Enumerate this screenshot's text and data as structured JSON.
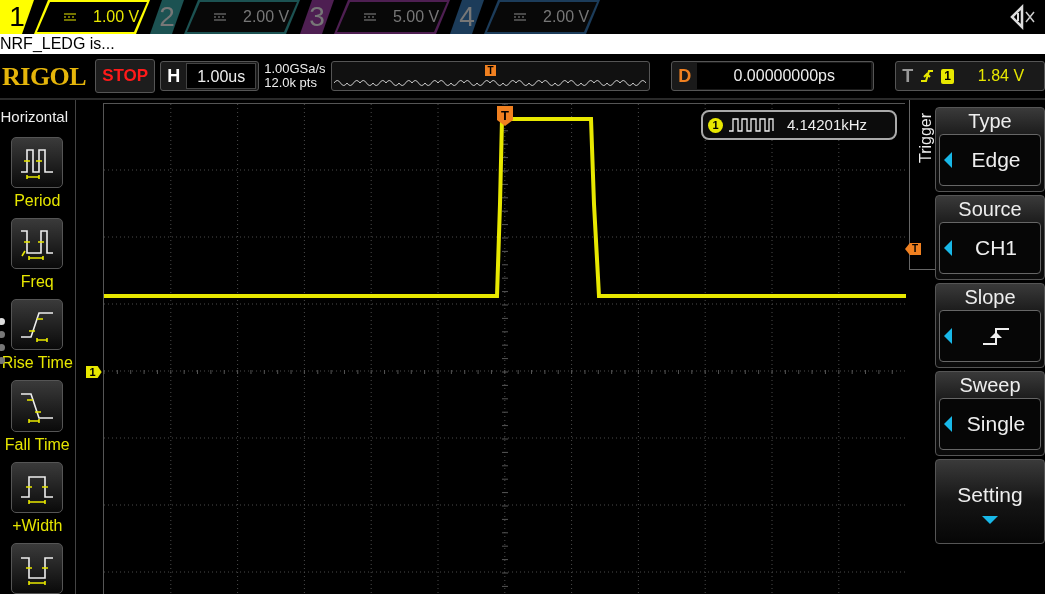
{
  "channels": [
    {
      "number": "1",
      "scale": "1.00 V",
      "color": "#ffff00",
      "selected": true
    },
    {
      "number": "2",
      "scale": "2.00 V",
      "color": "#1c5252",
      "selected": false
    },
    {
      "number": "3",
      "scale": "5.00 V",
      "color": "#4e1f52",
      "selected": false
    },
    {
      "number": "4",
      "scale": "2.00 V",
      "color": "#1c3c5a",
      "selected": false
    }
  ],
  "label_strip": "NRF_LEDG is...",
  "header": {
    "logo": "RIGOL",
    "run_state": "STOP",
    "timebase": {
      "key": "H",
      "value": "1.00us"
    },
    "sample_rate": "1.00GSa/s",
    "memory_depth": "12.0k pts",
    "memory_marker": "T",
    "delay": {
      "key": "D",
      "value": "0.00000000ps"
    },
    "trigger": {
      "key": "T",
      "source": "1",
      "level": "1.84 V"
    }
  },
  "measure_panel": {
    "title": "Horizontal",
    "items": [
      {
        "kind": "period",
        "label": "Period"
      },
      {
        "kind": "freq",
        "label": "Freq"
      },
      {
        "kind": "rise",
        "label": "Rise Time"
      },
      {
        "kind": "fall",
        "label": "Fall Time"
      },
      {
        "kind": "pos_width",
        "label": "+Width"
      },
      {
        "kind": "neg_width"
      }
    ]
  },
  "display": {
    "channel_marker": "1",
    "trigger_position_marker": "T",
    "trigger_level_marker": "T",
    "measurement": {
      "channel": "1",
      "value": "4.14201kHz"
    }
  },
  "menu": {
    "tab": "Trigger",
    "items": [
      {
        "kind": "select",
        "title": "Type",
        "value": "Edge"
      },
      {
        "kind": "select",
        "title": "Source",
        "value": "CH1"
      },
      {
        "kind": "slope",
        "title": "Slope"
      },
      {
        "kind": "select",
        "title": "Sweep",
        "value": "Single"
      },
      {
        "kind": "submenu",
        "title": "Setting"
      }
    ]
  }
}
